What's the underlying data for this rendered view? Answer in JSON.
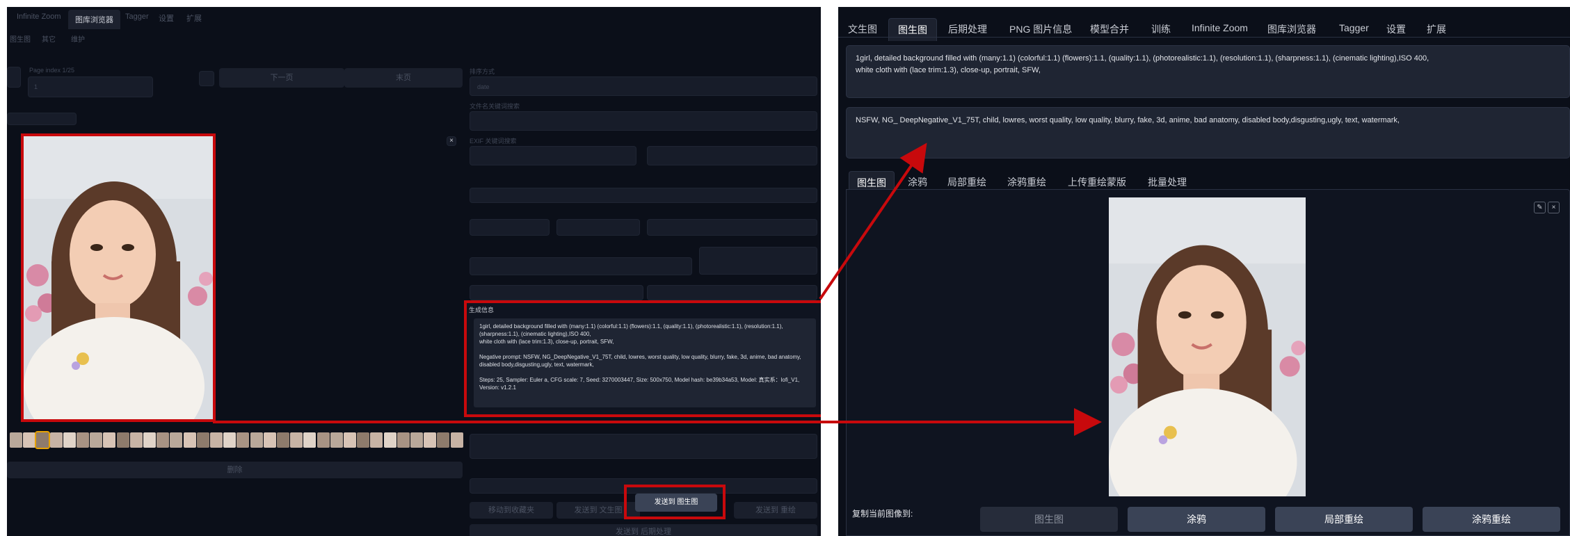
{
  "left": {
    "tabs": [
      "Infinite Zoom",
      "图库浏览器",
      "Tagger",
      "设置",
      "扩展"
    ],
    "active_tab_index": 1,
    "subtabs": [
      "图生图",
      "其它",
      "维护"
    ],
    "page_index_label": "Page index 1/25",
    "page_index_value": "1",
    "next_page_label": "下一页",
    "end_page_label": "末页",
    "sort_label": "排序方式",
    "sort_value": "date",
    "filename_keyword_label": "文件名关键词搜索",
    "exif_keyword_label": "EXIF 关键词搜索",
    "generation_info": {
      "title": "生成信息",
      "text": "1girl, detailed background filled with (many:1.1) (colorful:1.1) (flowers):1.1, (quality:1.1), (photorealistic:1.1), (resolution:1.1), (sharpness:1.1), (cinematic lighting),ISO 400,\nwhite cloth with (lace trim:1.3), close-up, portrait, SFW,\n\nNegative prompt: NSFW, NG_DeepNegative_V1_75T, child, lowres, worst quality, low quality, blurry, fake, 3d, anime, bad anatomy, disabled body,disgusting,ugly, text, watermark,\n\nSteps: 25, Sampler: Euler a, CFG scale: 7, Seed: 3270003447, Size: 500x750, Model hash: be39b34a53, Model: 真实系：lofi_V1,\nVersion: v1.2.1"
    },
    "buttons": {
      "delete": "删除",
      "move_to_favorites": "移动到收藏夹",
      "send_to_txt2img": "发送到 文生图",
      "send_to_img2img": "发送到 图生图",
      "send_to_inpaint": "发送到 重绘",
      "send_to_extras": "发送到 后期处理"
    }
  },
  "right": {
    "tabs": [
      "文生图",
      "图生图",
      "后期处理",
      "PNG 图片信息",
      "模型合并",
      "训练",
      "Infinite Zoom",
      "图库浏览器",
      "Tagger",
      "设置",
      "扩展"
    ],
    "active_tab_index": 1,
    "prompt": "1girl, detailed background filled with (many:1.1) (colorful:1.1) (flowers):1.1, (quality:1.1), (photorealistic:1.1), (resolution:1.1), (sharpness:1.1), (cinematic lighting),ISO 400,\nwhite cloth with (lace trim:1.3), close-up, portrait, SFW,",
    "negative_prompt": "NSFW, NG_ DeepNegative_V1_75T, child, lowres, worst quality, low quality, blurry, fake, 3d, anime, bad anatomy, disabled body,disgusting,ugly, text, watermark,",
    "sub_tabs": [
      "图生图",
      "涂鸦",
      "局部重绘",
      "涂鸦重绘",
      "上传重绘蒙版",
      "批量处理"
    ],
    "active_sub_tab_index": 0,
    "copy_label": "复制当前图像到:",
    "copy_buttons": [
      "图生图",
      "涂鸦",
      "局部重绘",
      "涂鸦重绘"
    ]
  },
  "colors": {
    "highlight": "#c8090c",
    "panel_bg": "#0b0f19",
    "box_bg": "#1f2533"
  }
}
